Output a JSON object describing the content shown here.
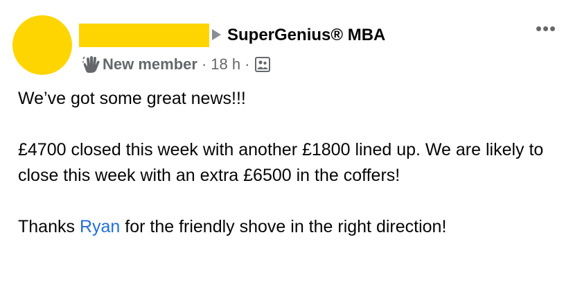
{
  "header": {
    "group_name": "SuperGenius® MBA",
    "badge": "New member",
    "separator": "·",
    "timestamp": "18 h",
    "audience_icon": "group-audience-icon",
    "redaction_color": "#FFD500"
  },
  "post": {
    "line1": "We’ve got some great news!!!",
    "line2": "£4700 closed this week with another £1800 lined up. We are likely to close this week with an extra £6500 in the coffers!",
    "line3_before": "Thanks ",
    "line3_link": "Ryan",
    "line3_after": " for the friendly shove in the right direction!",
    "link_color": "#216FDB"
  }
}
